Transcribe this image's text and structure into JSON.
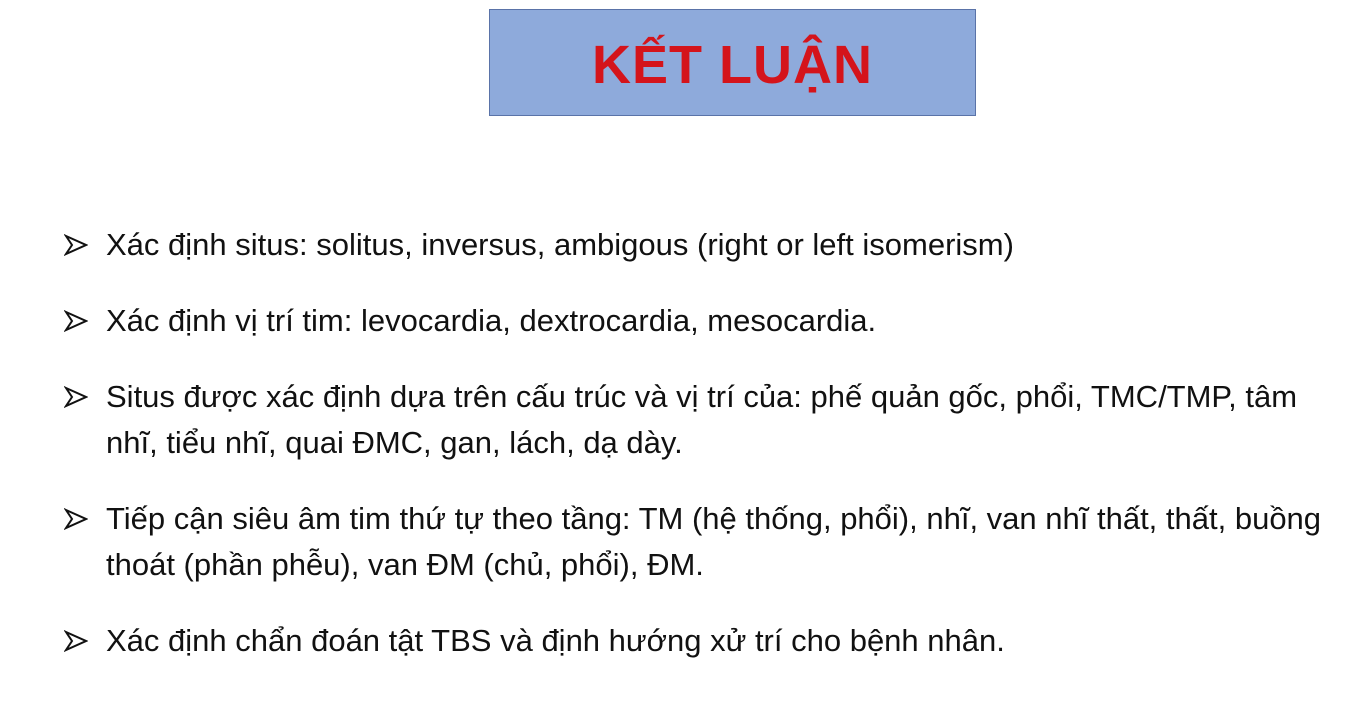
{
  "slide": {
    "title": "KẾT LUẬN",
    "bullets": [
      "Xác định situs: solitus, inversus, ambigous (right or left isomerism)",
      "Xác định vị trí tim: levocardia, dextrocardia, mesocardia.",
      "Situs được xác định dựa trên cấu trúc và vị trí của: phế quản gốc, phổi, TMC/TMP, tâm nhĩ, tiểu nhĩ, quai ĐMC, gan, lách, dạ dày.",
      "Tiếp cận siêu âm tim thứ tự theo tầng: TM (hệ thống, phổi), nhĩ, van nhĩ thất, thất, buồng thoát (phần phễu), van ĐM (chủ, phổi), ĐM.",
      "Xác định chẩn đoán tật TBS và định hướng xử trí cho bệnh nhân."
    ],
    "bullet_icon": "arrowhead-bullet-icon",
    "colors": {
      "title_text": "#d4141b",
      "title_background": "#8eaadb",
      "body_text": "#111111"
    }
  }
}
